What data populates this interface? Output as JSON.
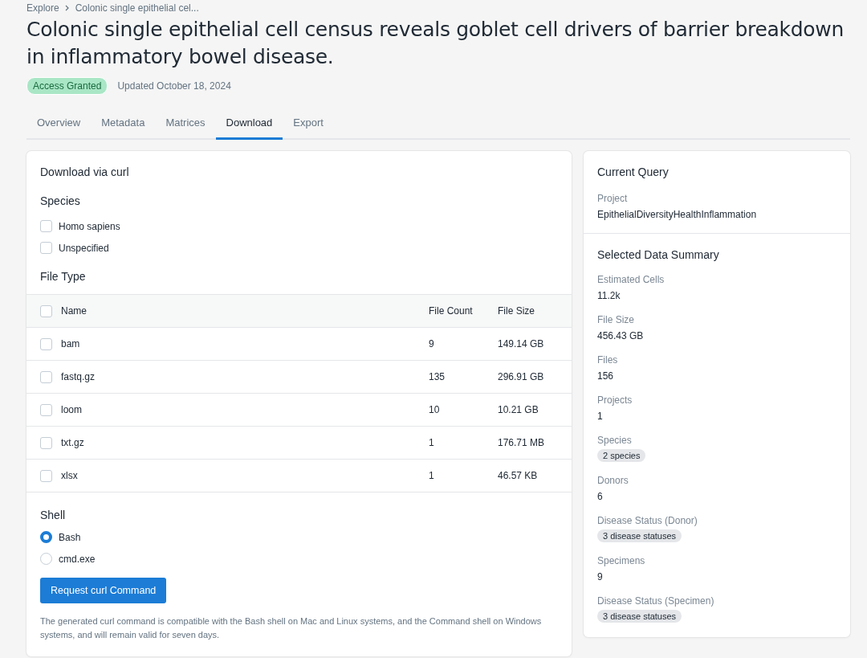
{
  "breadcrumb": [
    {
      "label": "Explore"
    },
    {
      "label": "Colonic single epithelial cel..."
    }
  ],
  "title": "Colonic single epithelial cell census reveals goblet cell drivers of barrier breakdown in inflammatory bowel disease.",
  "access_badge": "Access Granted",
  "updated": "Updated October 18, 2024",
  "tabs": [
    {
      "label": "Overview",
      "selected": false
    },
    {
      "label": "Metadata",
      "selected": false
    },
    {
      "label": "Matrices",
      "selected": false
    },
    {
      "label": "Download",
      "selected": true
    },
    {
      "label": "Export",
      "selected": false
    }
  ],
  "download": {
    "title": "Download via curl",
    "species_heading": "Species",
    "species": [
      {
        "label": "Homo sapiens",
        "checked": false
      },
      {
        "label": "Unspecified",
        "checked": false
      }
    ],
    "file_type_heading": "File Type",
    "table": {
      "all_checked": false,
      "columns": [
        "Name",
        "File Count",
        "File Size"
      ],
      "rows": [
        {
          "name": "bam",
          "count": "9",
          "size": "149.14 GB",
          "checked": false
        },
        {
          "name": "fastq.gz",
          "count": "135",
          "size": "296.91 GB",
          "checked": false
        },
        {
          "name": "loom",
          "count": "10",
          "size": "10.21 GB",
          "checked": false
        },
        {
          "name": "txt.gz",
          "count": "1",
          "size": "176.71 MB",
          "checked": false
        },
        {
          "name": "xlsx",
          "count": "1",
          "size": "46.57 KB",
          "checked": false
        }
      ]
    },
    "shell_heading": "Shell",
    "shells": [
      {
        "label": "Bash",
        "selected": true
      },
      {
        "label": "cmd.exe",
        "selected": false
      }
    ],
    "button": "Request curl Command",
    "note": "The generated curl command is compatible with the Bash shell on Mac and Linux systems, and the Command shell on Windows systems, and will remain valid for seven days."
  },
  "query": {
    "title": "Current Query",
    "label": "Project",
    "value": "EpithelialDiversityHealthInflammation"
  },
  "summary": {
    "title": "Selected Data Summary",
    "items": [
      {
        "label": "Estimated Cells",
        "value": "11.2k",
        "kind": "text"
      },
      {
        "label": "File Size",
        "value": "456.43 GB",
        "kind": "text"
      },
      {
        "label": "Files",
        "value": "156",
        "kind": "text"
      },
      {
        "label": "Projects",
        "value": "1",
        "kind": "text"
      },
      {
        "label": "Species",
        "value": "2 species",
        "kind": "tag"
      },
      {
        "label": "Donors",
        "value": "6",
        "kind": "text"
      },
      {
        "label": "Disease Status (Donor)",
        "value": "3 disease statuses",
        "kind": "tag"
      },
      {
        "label": "Specimens",
        "value": "9",
        "kind": "text"
      },
      {
        "label": "Disease Status (Specimen)",
        "value": "3 disease statuses",
        "kind": "tag"
      }
    ]
  }
}
